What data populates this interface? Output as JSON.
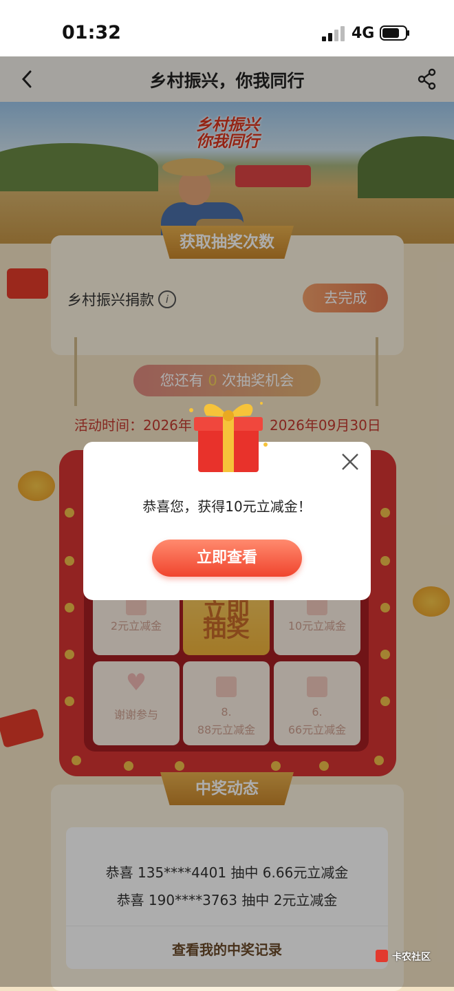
{
  "status_bar": {
    "time": "01:32",
    "network": "4G"
  },
  "header": {
    "title": "乡村振兴，你我同行"
  },
  "banner": {
    "slogan_line1": "乡村振兴",
    "slogan_line2": "你我同行"
  },
  "get_chances": {
    "section_title": "获取抽奖次数",
    "task_label": "乡村振兴捐款",
    "task_button": "去完成"
  },
  "lottery": {
    "chance_prefix": "您还有",
    "chance_count": "0",
    "chance_suffix": "次抽奖机会",
    "time_prefix": "活动时间：2026年",
    "time_end": "2026年09月30日",
    "cells": [
      {
        "label": "2元立减金"
      },
      {
        "label": "立即",
        "label2": "抽奖"
      },
      {
        "label": "10元立减金"
      },
      {
        "label": "谢谢参与"
      },
      {
        "label": "8.",
        "label2": "88元立减金"
      },
      {
        "label": "6.",
        "label2": "66元立减金"
      }
    ]
  },
  "winners": {
    "section_title": "中奖动态",
    "items": [
      "恭喜 135****4401 抽中 6.66元立减金",
      "恭喜 190****3763 抽中 2元立减金"
    ],
    "record_link": "查看我的中奖记录"
  },
  "modal": {
    "message": "恭喜您，获得10元立减金！",
    "button": "立即查看"
  },
  "watermark": "卡农社区",
  "colors": {
    "primary_red": "#d73433",
    "gold": "#e8b04e",
    "button_orange": "#f0452e"
  }
}
